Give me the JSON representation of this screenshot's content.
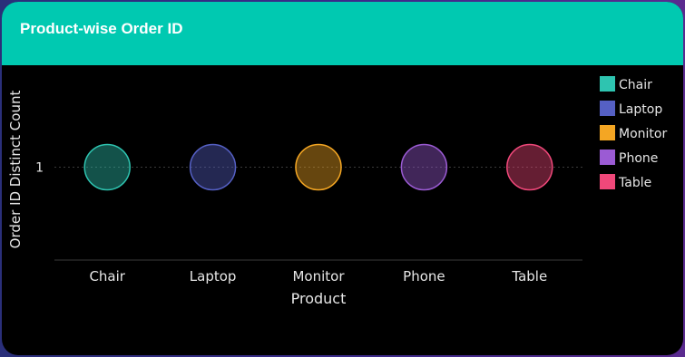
{
  "card": {
    "title": "Product-wise Order ID"
  },
  "chart_data": {
    "type": "scatter",
    "title": "Product-wise Order ID",
    "xlabel": "Product",
    "ylabel": "Order ID Distinct Count",
    "categories": [
      "Chair",
      "Laptop",
      "Monitor",
      "Phone",
      "Table"
    ],
    "values": [
      1,
      1,
      1,
      1,
      1
    ],
    "y_ticks": [
      "1"
    ],
    "grid": true,
    "legend_placement": "top-right",
    "legend": [
      {
        "label": "Chair",
        "color": "#2ec4b0"
      },
      {
        "label": "Laptop",
        "color": "#5560c4"
      },
      {
        "label": "Monitor",
        "color": "#f4a623"
      },
      {
        "label": "Phone",
        "color": "#9b5bd4"
      },
      {
        "label": "Table",
        "color": "#f0487a"
      }
    ]
  },
  "colors": {
    "header": "#00c9b1",
    "background": "#000000"
  }
}
